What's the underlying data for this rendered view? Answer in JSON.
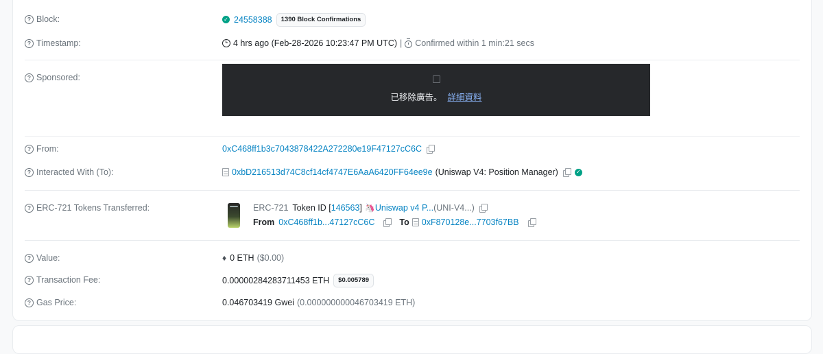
{
  "block": {
    "label": "Block:",
    "number": "24558388",
    "confirmations": "1390 Block Confirmations"
  },
  "timestamp": {
    "label": "Timestamp:",
    "value": "4 hrs ago (Feb-28-2026 10:23:47 PM UTC)",
    "separator": "|",
    "confirmed": "Confirmed within 1 min:21 secs"
  },
  "sponsored": {
    "label": "Sponsored:",
    "ad_text": "已移除廣告。",
    "ad_link": "詳細資料"
  },
  "from": {
    "label": "From:",
    "address": "0xC468ff1b3c7043878422A272280e19F47127cC6C"
  },
  "interacted": {
    "label": "Interacted With (To):",
    "address": "0xbD216513d74C8cf14cf4747E6AaA6420FF64ee9e",
    "name": "(Uniswap V4: Position Manager)"
  },
  "erc721": {
    "label": "ERC-721 Tokens Transferred:",
    "standard": "ERC-721",
    "token_id_prefix": "Token ID [",
    "token_id": "146563",
    "token_id_suffix": "]",
    "token_name": "Uniswap v4 P...",
    "token_symbol": "(UNI-V4...)",
    "from_label": "From",
    "from_address": "0xC468ff1b...47127cC6C",
    "to_label": "To",
    "to_address": "0xF870128e...7703f67BB"
  },
  "value": {
    "label": "Value:",
    "amount": "0 ETH",
    "usd": "($0.00)"
  },
  "fee": {
    "label": "Transaction Fee:",
    "amount": "0.00000284283711453 ETH",
    "usd": "$0.005789"
  },
  "gas": {
    "label": "Gas Price:",
    "amount": "0.046703419 Gwei",
    "eth": "(0.000000000046703419 ETH)"
  },
  "icons": {
    "question": "question-circle-icon",
    "copy": "copy-icon",
    "contract": "contract-file-icon",
    "verified": "verified-check-icon",
    "clock": "clock-icon",
    "stopwatch": "stopwatch-icon",
    "eth": "ethereum-icon"
  },
  "colors": {
    "link": "#0784c3",
    "muted": "#6c757d",
    "success": "#00a186",
    "ad_background": "#26282b"
  }
}
